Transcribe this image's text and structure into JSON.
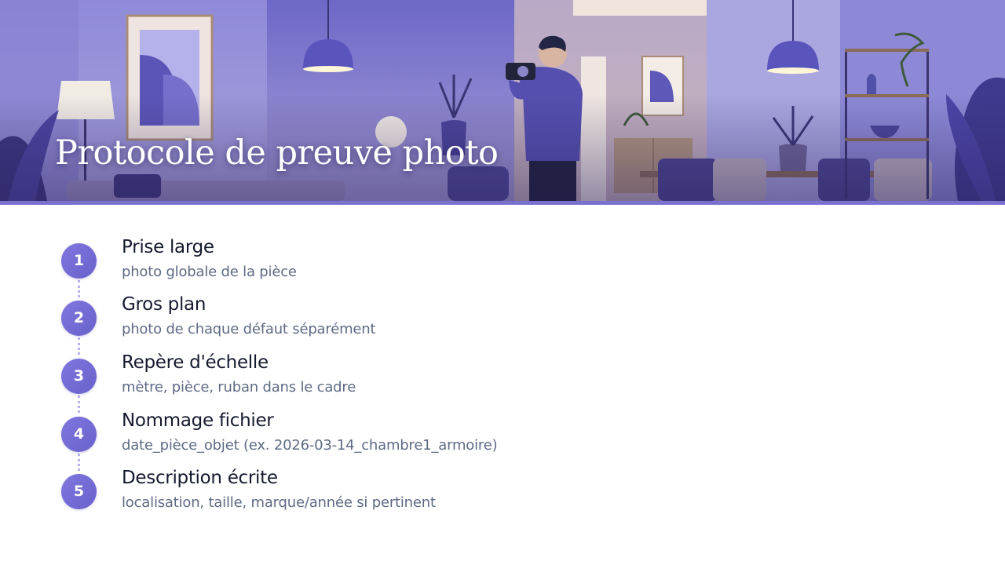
{
  "hero": {
    "title": "Protocole de preuve photo",
    "illustration": "person-photographing-room-interior"
  },
  "colors": {
    "accent": "#7a70d0",
    "badge": "#7b73da",
    "title_text": "#151a2e",
    "subtitle_text": "#5e6a84"
  },
  "steps": [
    {
      "number": "1",
      "title": "Prise large",
      "subtitle": "photo globale de la pièce"
    },
    {
      "number": "2",
      "title": "Gros plan",
      "subtitle": "photo de chaque défaut séparément"
    },
    {
      "number": "3",
      "title": "Repère d'échelle",
      "subtitle": "mètre, pièce, ruban dans le cadre"
    },
    {
      "number": "4",
      "title": "Nommage fichier",
      "subtitle": "date_pièce_objet (ex. 2026-03-14_chambre1_armoire)"
    },
    {
      "number": "5",
      "title": "Description écrite",
      "subtitle": "localisation, taille, marque/année si pertinent"
    }
  ]
}
